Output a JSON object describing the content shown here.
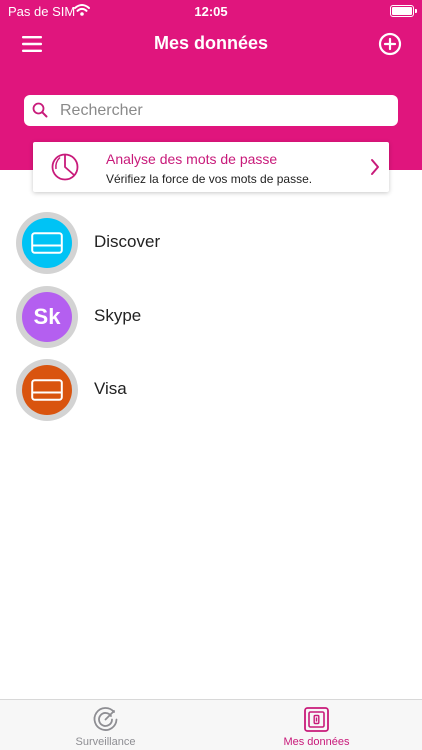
{
  "status_bar": {
    "carrier": "Pas de SIM",
    "time": "12:05"
  },
  "nav": {
    "title": "Mes données",
    "menu_icon": "hamburger-icon",
    "add_icon": "plus-circle-icon"
  },
  "search": {
    "placeholder": "Rechercher",
    "value": ""
  },
  "analysis": {
    "title": "Analyse des mots de passe",
    "subtitle": "Vérifiez la force de vos mots de passe.",
    "icon": "gauge-icon"
  },
  "items": [
    {
      "label": "Discover",
      "icon": "credit-card-icon",
      "color": "#00c3f5"
    },
    {
      "label": "Skype",
      "initials": "Sk",
      "color": "#b45ff0"
    },
    {
      "label": "Visa",
      "icon": "credit-card-icon",
      "color": "#d9540f"
    }
  ],
  "tabs": [
    {
      "label": "Surveillance",
      "icon": "radar-icon",
      "active": false
    },
    {
      "label": "Mes données",
      "icon": "vault-icon",
      "active": true
    }
  ],
  "colors": {
    "brand": "#e0157d",
    "accent_text": "#c81a7a",
    "inactive_tab": "#8e8e93"
  }
}
